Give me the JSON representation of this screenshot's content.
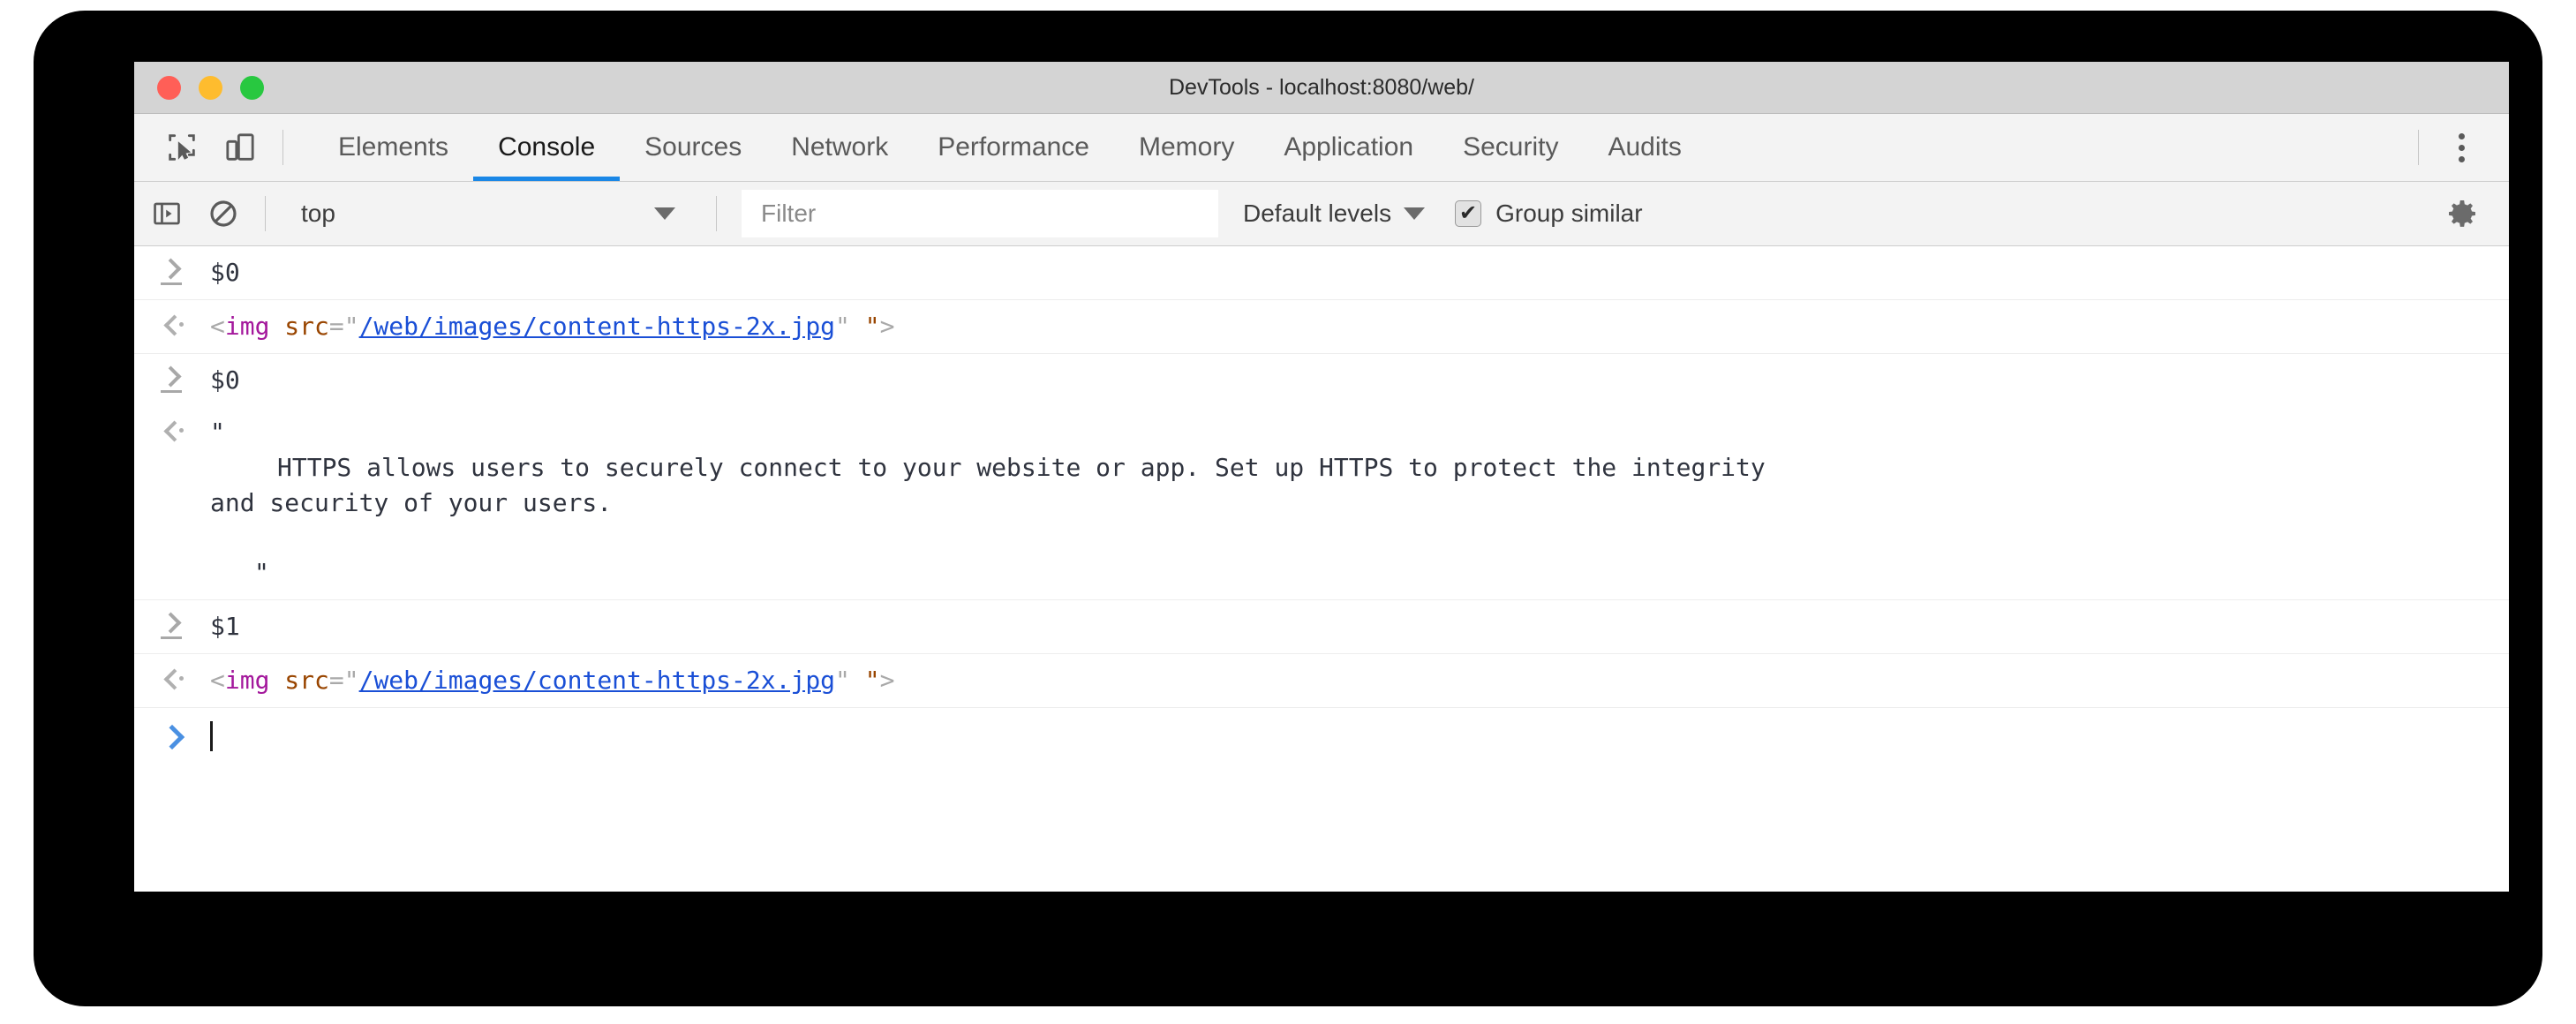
{
  "window": {
    "title": "DevTools - localhost:8080/web/",
    "traffic_lights": [
      {
        "name": "close",
        "color": "#ff5f57"
      },
      {
        "name": "minimize",
        "color": "#febc2e"
      },
      {
        "name": "zoom",
        "color": "#28c840"
      }
    ]
  },
  "tabstrip": {
    "icons": [
      {
        "name": "inspect-element-icon"
      },
      {
        "name": "device-toolbar-icon"
      }
    ],
    "tabs": [
      {
        "label": "Elements",
        "active": false
      },
      {
        "label": "Console",
        "active": true
      },
      {
        "label": "Sources",
        "active": false
      },
      {
        "label": "Network",
        "active": false
      },
      {
        "label": "Performance",
        "active": false
      },
      {
        "label": "Memory",
        "active": false
      },
      {
        "label": "Application",
        "active": false
      },
      {
        "label": "Security",
        "active": false
      },
      {
        "label": "Audits",
        "active": false
      }
    ],
    "menu_icon": "more-vertical-icon",
    "active_accent": "#1a87e6"
  },
  "console_toolbar": {
    "sidebar_toggle_icon": "console-sidebar-icon",
    "clear_icon": "clear-console-icon",
    "context": "top",
    "filter_placeholder": "Filter",
    "filter_value": "",
    "levels_label": "Default levels",
    "group_similar_label": "Group similar",
    "group_similar_checked": true,
    "checkmark": "✔",
    "settings_icon": "gear-icon"
  },
  "console": {
    "rows": [
      {
        "kind": "input",
        "marker": "input-chevron-icon",
        "text": "$0"
      },
      {
        "kind": "output",
        "marker": "output-chevron-icon",
        "tokens": [
          {
            "type": "punct",
            "text": "<"
          },
          {
            "type": "tag",
            "text": "img"
          },
          {
            "type": "punct",
            "text": " "
          },
          {
            "type": "attr",
            "text": "src"
          },
          {
            "type": "punct",
            "text": "="
          },
          {
            "type": "quote",
            "text": "\""
          },
          {
            "type": "link",
            "text": "/web/images/content-https-2x.jpg"
          },
          {
            "type": "quote",
            "text": "\""
          },
          {
            "type": "punct",
            "text": " "
          },
          {
            "type": "quote-attr",
            "text": "\""
          },
          {
            "type": "punct",
            "text": ">"
          }
        ]
      },
      {
        "kind": "input",
        "marker": "input-chevron-icon",
        "text": "$1"
      }
    ],
    "string_output": {
      "marker": "output-chevron-icon",
      "open_quote": "\"",
      "body_line1": "HTTPS allows users to securely connect to your website or app. Set up HTTPS to protect the integrity",
      "body_line2": "and security of your users.",
      "close_quote": "\""
    },
    "prompt": {
      "marker": "prompt-chevron-icon",
      "value": "",
      "caret_visible": true
    }
  }
}
